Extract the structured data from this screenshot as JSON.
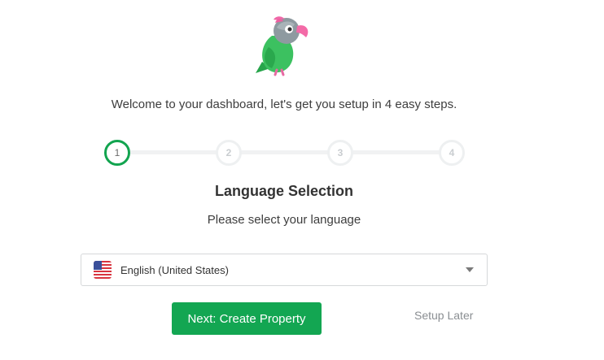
{
  "logo": {
    "icon": "parrot-logo"
  },
  "welcome_text": "Welcome to your dashboard, let's get you setup in 4 easy steps.",
  "stepper": {
    "steps": [
      "1",
      "2",
      "3",
      "4"
    ],
    "active_step": 1
  },
  "section": {
    "title": "Language Selection",
    "subtitle": "Please select your language"
  },
  "language_select": {
    "flag_icon": "us-flag-icon",
    "value": "English (United States)"
  },
  "actions": {
    "next_label": "Next: Create Property",
    "setup_later_label": "Setup Later"
  },
  "colors": {
    "primary_green": "#13a652",
    "step_inactive": "#eef0f1"
  }
}
